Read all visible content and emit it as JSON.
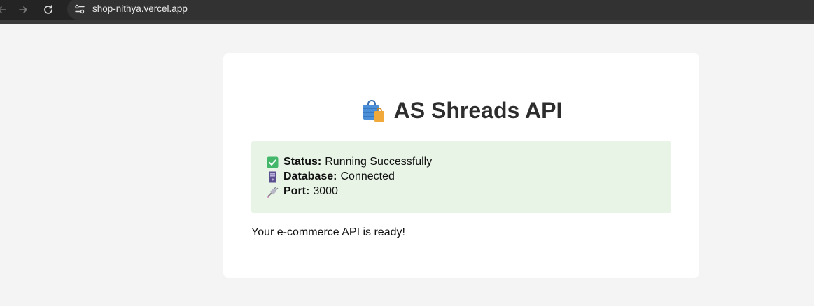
{
  "browser": {
    "url": "shop-nithya.vercel.app"
  },
  "page": {
    "title": "AS Shreads API",
    "title_icon": "shopping-bag-icon",
    "status_items": [
      {
        "icon": "check-mark-icon",
        "label": "Status:",
        "value": "Running Successfully"
      },
      {
        "icon": "database-server-icon",
        "label": "Database:",
        "value": "Connected"
      },
      {
        "icon": "plug-icon",
        "label": "Port:",
        "value": "3000"
      }
    ],
    "footer": "Your e-commerce API is ready!"
  },
  "colors": {
    "page_background": "#f4f4f4",
    "card_background": "#ffffff",
    "status_background": "#e8f4e6",
    "title_text": "#2d2d2d",
    "browser_bar": "#242424"
  }
}
